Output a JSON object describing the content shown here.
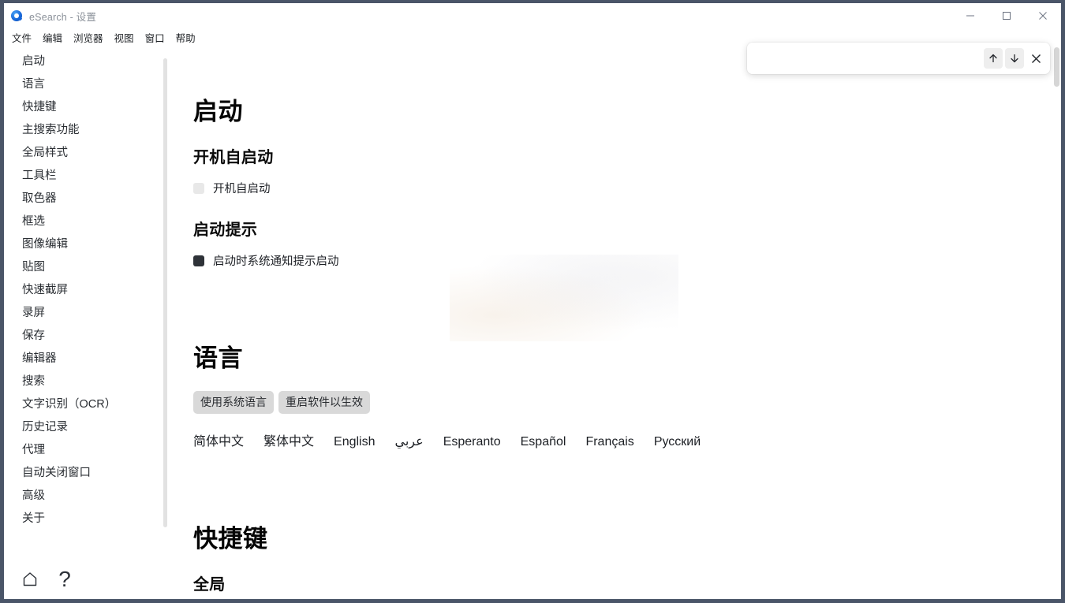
{
  "window": {
    "title": "eSearch - 设置",
    "logo_icon": "esearch-logo-icon",
    "controls": {
      "minimize_label": "最小化",
      "maximize_label": "最大化",
      "close_label": "关闭"
    },
    "border_color": "#4a5568"
  },
  "menu": {
    "items": [
      {
        "label": "文件"
      },
      {
        "label": "编辑"
      },
      {
        "label": "浏览器"
      },
      {
        "label": "视图"
      },
      {
        "label": "窗口"
      },
      {
        "label": "帮助"
      }
    ]
  },
  "sidebar": {
    "items": [
      {
        "label": "启动"
      },
      {
        "label": "语言"
      },
      {
        "label": "快捷键"
      },
      {
        "label": "主搜索功能"
      },
      {
        "label": "全局样式"
      },
      {
        "label": "工具栏"
      },
      {
        "label": "取色器"
      },
      {
        "label": "框选"
      },
      {
        "label": "图像编辑"
      },
      {
        "label": "贴图"
      },
      {
        "label": "快速截屏"
      },
      {
        "label": "录屏"
      },
      {
        "label": "保存"
      },
      {
        "label": "编辑器"
      },
      {
        "label": "搜索"
      },
      {
        "label": "文字识别（OCR）"
      },
      {
        "label": "历史记录"
      },
      {
        "label": "代理"
      },
      {
        "label": "自动关闭窗口"
      },
      {
        "label": "高级"
      },
      {
        "label": "关于"
      }
    ]
  },
  "bottom_bar": {
    "home_icon": "home-icon",
    "help_icon": "question-mark-icon",
    "help_label": "?"
  },
  "find_bar": {
    "value": "",
    "placeholder": "",
    "prev_icon": "arrow-up-icon",
    "next_icon": "arrow-down-icon",
    "close_icon": "close-icon"
  },
  "main": {
    "startup": {
      "title": "启动",
      "autostart": {
        "heading": "开机自启动",
        "checkbox_label": "开机自启动",
        "checked": false
      },
      "notice": {
        "heading": "启动提示",
        "checkbox_label": "启动时系统通知提示启动",
        "checked": true
      }
    },
    "language": {
      "title": "语言",
      "chips": [
        {
          "label": "使用系统语言"
        },
        {
          "label": "重启软件以生效"
        }
      ],
      "options": [
        {
          "label": "简体中文"
        },
        {
          "label": "繁体中文"
        },
        {
          "label": "English"
        },
        {
          "label": "عربي"
        },
        {
          "label": "Esperanto"
        },
        {
          "label": "Español"
        },
        {
          "label": "Français"
        },
        {
          "label": "Русский"
        }
      ]
    },
    "shortcuts": {
      "title": "快捷键",
      "subtitle": "全局"
    }
  },
  "colors": {
    "accent": "#1565d8",
    "text": "#1c1f24",
    "chip_bg": "#d9d9d9",
    "checkbox_on": "#2e3238",
    "checkbox_off": "#e8e8e8",
    "window_border": "#4a5568"
  }
}
